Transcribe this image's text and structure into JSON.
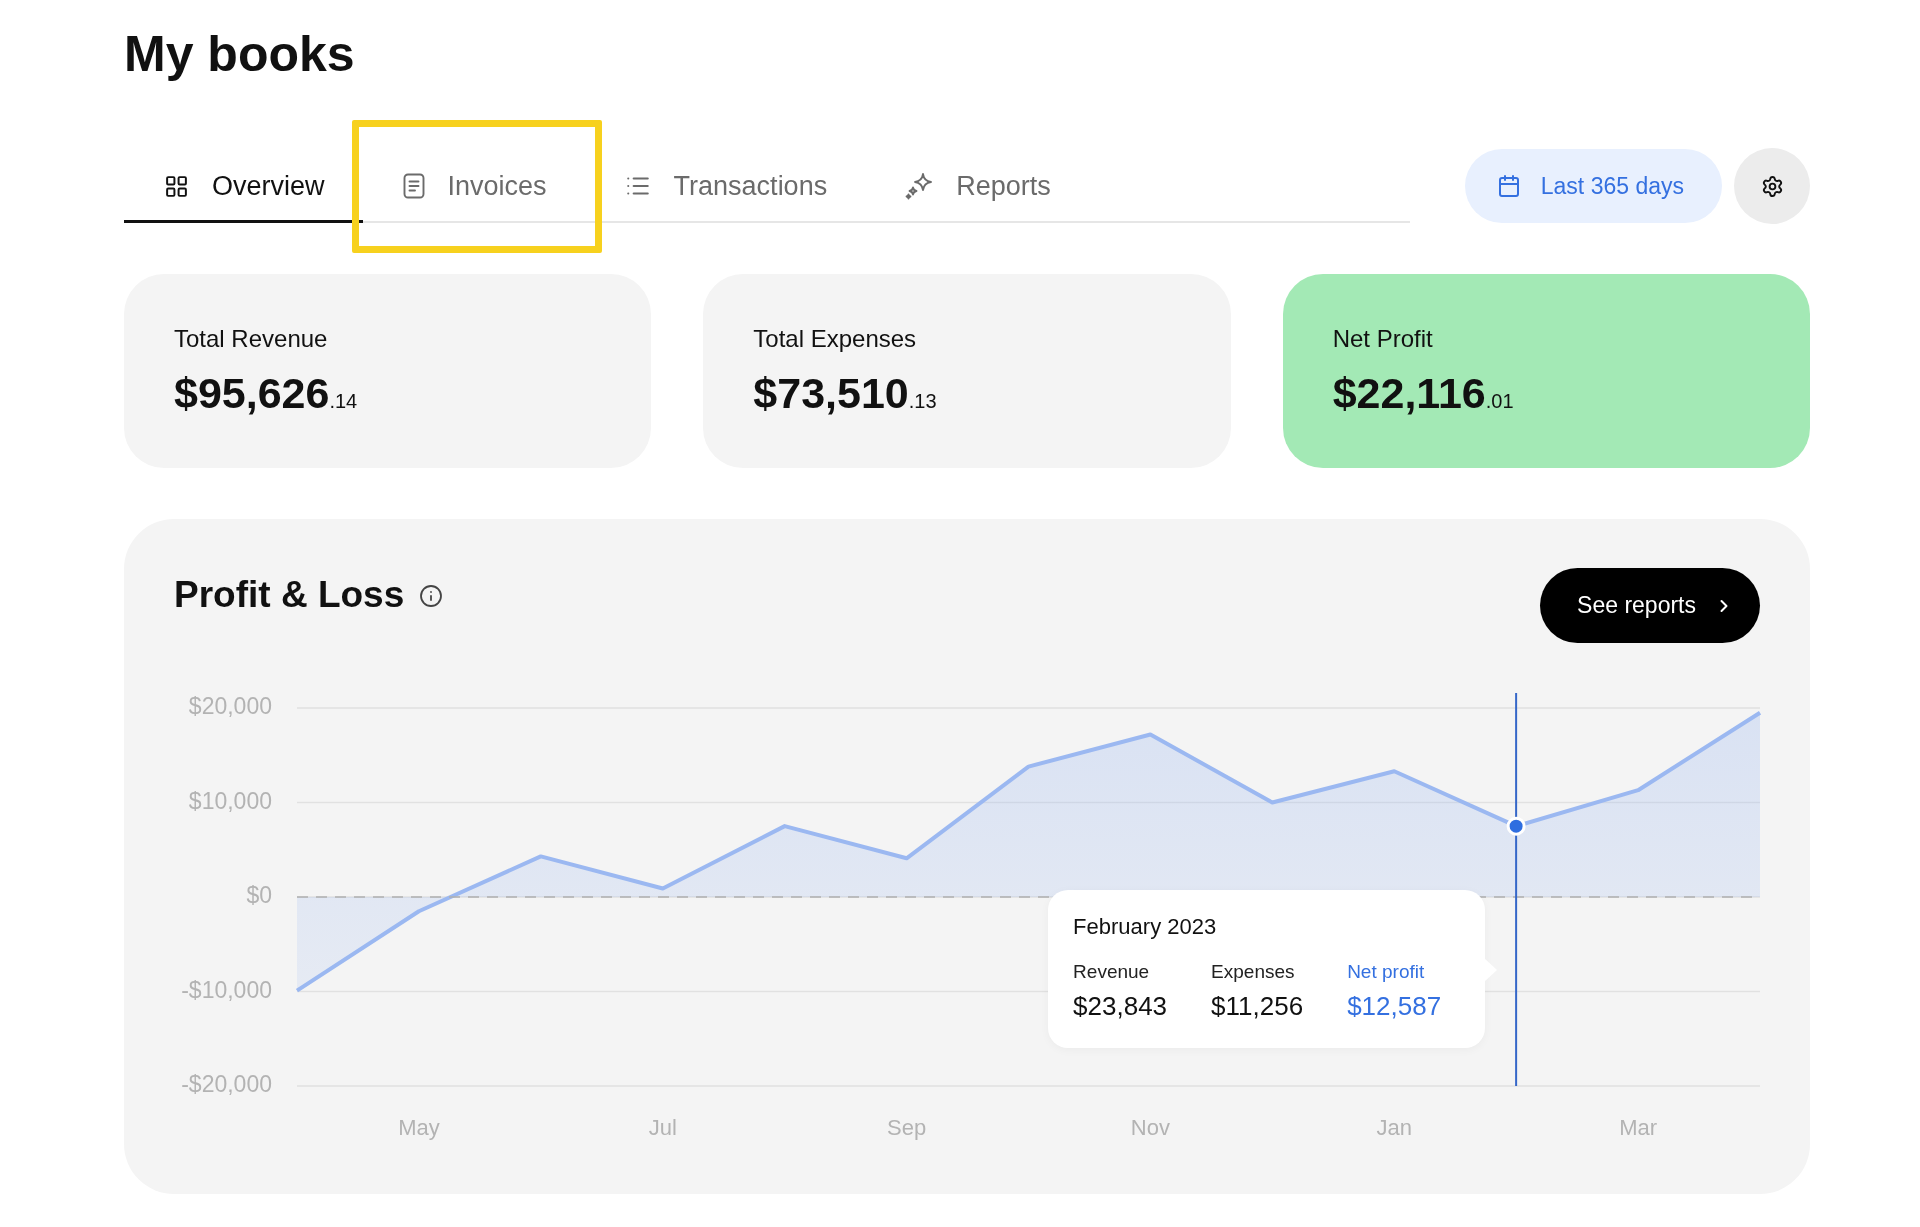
{
  "page": {
    "title": "My books"
  },
  "tabs": [
    {
      "label": "Overview",
      "selected": true,
      "highlighted": false
    },
    {
      "label": "Invoices",
      "selected": false,
      "highlighted": true
    },
    {
      "label": "Transactions",
      "selected": false,
      "highlighted": false
    },
    {
      "label": "Reports",
      "selected": false,
      "highlighted": false
    }
  ],
  "date_range": {
    "label": "Last 365 days"
  },
  "summary_cards": [
    {
      "label": "Total Revenue",
      "amount": "$95,626",
      "cents": ".14",
      "highlighted": false
    },
    {
      "label": "Total Expenses",
      "amount": "$73,510",
      "cents": ".13",
      "highlighted": false
    },
    {
      "label": "Net Profit",
      "amount": "$22,116",
      "cents": ".01",
      "highlighted": true
    }
  ],
  "profit_loss": {
    "title": "Profit & Loss",
    "button": "See reports",
    "chart_data": {
      "type": "area",
      "grid": true,
      "categories": [
        null,
        "May",
        null,
        "Jul",
        null,
        "Sep",
        null,
        "Nov",
        null,
        "Jan",
        null,
        "Mar",
        null
      ],
      "ylim": [
        -20000,
        20000
      ],
      "yticks": [
        {
          "value": 20000,
          "label": "$20,000"
        },
        {
          "value": 10000,
          "label": "$10,000"
        },
        {
          "value": 0,
          "label": "$0"
        },
        {
          "value": -10000,
          "label": "-$10,000"
        },
        {
          "value": -20000,
          "label": "-$20,000"
        }
      ],
      "series": [
        {
          "color": "#9bb8f1",
          "values": [
            -9900,
            -1500,
            4300,
            900,
            7500,
            4100,
            13800,
            17200,
            10000,
            13300,
            7500,
            11300,
            19500
          ]
        }
      ],
      "ref_lines": [
        {
          "axis": "y",
          "value": 0
        }
      ]
    },
    "tooltip": {
      "level": 0.8333,
      "title": "February 2023",
      "items": [
        {
          "label": "Revenue",
          "value": "$23,843",
          "emphasized": false
        },
        {
          "label": "Expenses",
          "value": "$11,256",
          "emphasized": false
        },
        {
          "label": "Net profit",
          "value": "$12,587",
          "emphasized": true
        }
      ]
    }
  }
}
